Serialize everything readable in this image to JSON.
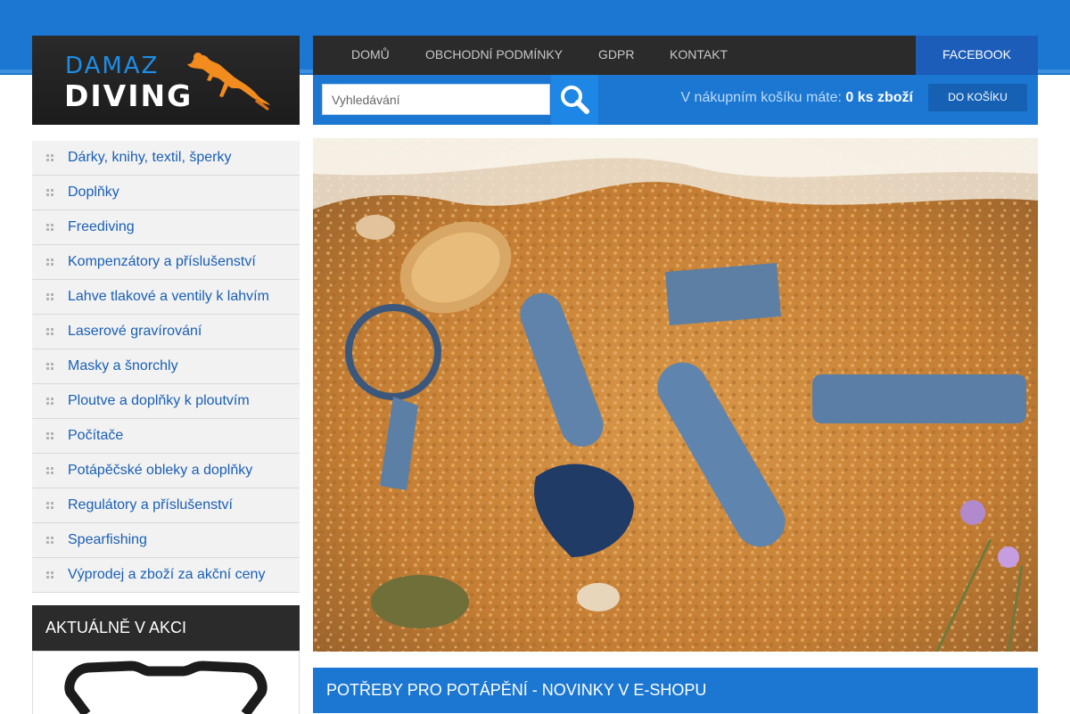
{
  "logo": {
    "line1": "DAMAZ",
    "line2": "DIVING"
  },
  "nav": {
    "items": [
      "DOMŮ",
      "OBCHODNÍ PODMÍNKY",
      "GDPR",
      "KONTAKT"
    ],
    "facebook": "FACEBOOK"
  },
  "search": {
    "placeholder": "Vyhledávání"
  },
  "cart": {
    "text": "V nákupním košíku máte:",
    "count": "0 ks zboží",
    "button": "DO KOŠÍKU"
  },
  "categories": [
    "Dárky, knihy, textil, šperky",
    "Doplňky",
    "Freediving",
    "Kompenzátory a příslušenství",
    "Lahve tlakové a ventily k lahvím",
    "Laserové gravírování",
    "Masky a šnorchly",
    "Ploutve a doplňky k ploutvím",
    "Počítače",
    "Potápěčské obleky a doplňky",
    "Regulátory a příslušenství",
    "Spearfishing",
    "Výprodej a zboží za akční ceny"
  ],
  "akce": {
    "title": "AKTUÁLNĚ V AKCI"
  },
  "news": {
    "title": "POTŘEBY PRO POTÁPĚNÍ - NOVINKY V E-SHOPU"
  },
  "colors": {
    "brand_blue": "#1b77d2",
    "dark_bar": "#2b2b2b",
    "link_blue": "#1a5fb4",
    "logo_orange": "#f28c1e"
  },
  "icons": {
    "search": "search-icon",
    "logo": "diver-icon",
    "bullet": "grid-bullet-icon"
  }
}
